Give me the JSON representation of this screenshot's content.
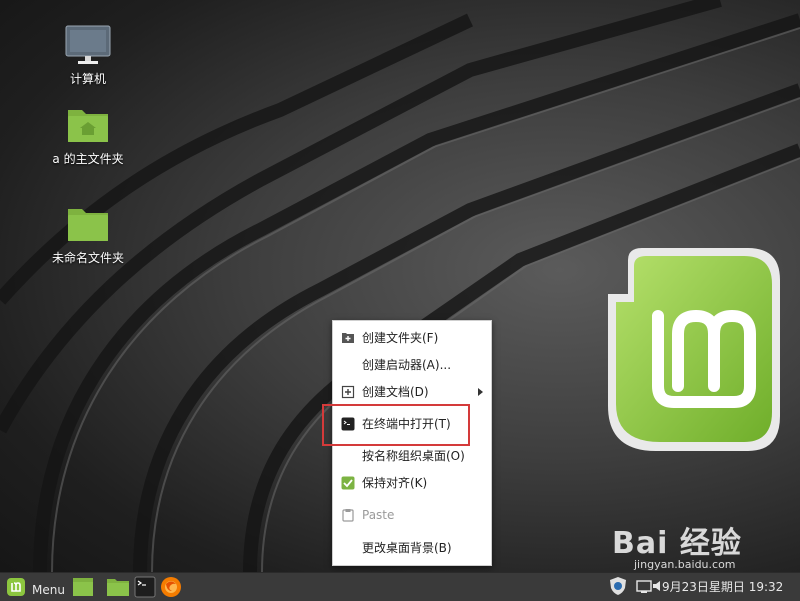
{
  "desktop": {
    "icons": [
      {
        "label": "计算机",
        "icon": "computer-icon"
      },
      {
        "label": "a 的主文件夹",
        "icon": "home-folder-icon"
      },
      {
        "label": "未命名文件夹",
        "icon": "folder-icon"
      }
    ]
  },
  "context_menu": {
    "items": [
      {
        "label": "创建文件夹(F)",
        "icon": "new-folder-icon"
      },
      {
        "label": "创建启动器(A)...",
        "icon": ""
      },
      {
        "label": "创建文档(D)",
        "icon": "add-document-icon",
        "submenu": true
      },
      {
        "label": "在终端中打开(T)",
        "icon": "terminal-icon"
      },
      {
        "label": "按名称组织桌面(O)",
        "icon": ""
      },
      {
        "label": "保持对齐(K)",
        "icon": "checkbox-checked-icon",
        "checked": true
      },
      {
        "label": "Paste",
        "icon": "clipboard-icon",
        "disabled": true
      },
      {
        "label": "更改桌面背景(B)",
        "icon": ""
      }
    ]
  },
  "panel": {
    "menu_label": "Menu",
    "clock": "9月23日星期日 19:32",
    "launchers": [
      "files-icon",
      "home-folder-icon",
      "terminal-icon",
      "firefox-icon"
    ],
    "tray": [
      "shield-icon",
      "display-icon",
      "volume-icon"
    ]
  },
  "watermark": {
    "brand": "Bai 经验",
    "url": "jingyan.baidu.com"
  },
  "colors": {
    "folder_green": "#8bc34a",
    "mint_green": "#8cc63f",
    "highlight_red": "#d43a3a",
    "panel_bg": "#3a3a3a"
  }
}
